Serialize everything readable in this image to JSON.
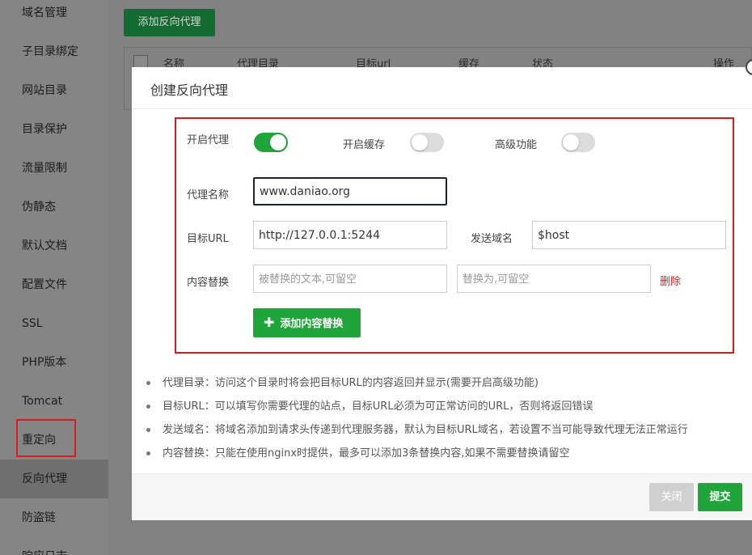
{
  "sidebar": {
    "items": [
      {
        "label": "域名管理"
      },
      {
        "label": "子目录绑定"
      },
      {
        "label": "网站目录"
      },
      {
        "label": "目录保护"
      },
      {
        "label": "流量限制"
      },
      {
        "label": "伪静态"
      },
      {
        "label": "默认文档"
      },
      {
        "label": "配置文件"
      },
      {
        "label": "SSL"
      },
      {
        "label": "PHP版本"
      },
      {
        "label": "Tomcat"
      },
      {
        "label": "重定向"
      },
      {
        "label": "反向代理"
      },
      {
        "label": "防盗链"
      },
      {
        "label": "响应日志"
      }
    ],
    "active": "反向代理"
  },
  "page": {
    "add_button": "添加反向代理",
    "table_headers": [
      "名称",
      "代理目录",
      "目标url",
      "缓存",
      "状态",
      "操作"
    ]
  },
  "modal": {
    "title": "创建反向代理",
    "toggles": {
      "enable_proxy": {
        "label": "开启代理",
        "on": true
      },
      "enable_cache": {
        "label": "开启缓存",
        "on": false
      },
      "advanced": {
        "label": "高级功能",
        "on": false
      }
    },
    "proxy_name": {
      "label": "代理名称",
      "value": "www.daniao.org"
    },
    "target_url": {
      "label": "目标URL",
      "value": "http://127.0.0.1:5244"
    },
    "send_domain": {
      "label": "发送域名",
      "value": "$host"
    },
    "content_replace": {
      "label": "内容替换",
      "from_placeholder": "被替换的文本,可留空",
      "to_placeholder": "替换为,可留空",
      "delete_label": "删除"
    },
    "add_replace_button": "添加内容替换",
    "help": [
      "代理目录：访问这个目录时将会把目标URL的内容返回并显示(需要开启高级功能)",
      "目标URL：可以填写你需要代理的站点，目标URL必须为可正常访问的URL，否则将返回错误",
      "发送域名：将域名添加到请求头传递到代理服务器，默认为目标URL域名，若设置不当可能导致代理无法正常运行",
      "内容替换：只能在使用nginx时提供，最多可以添加3条替换内容,如果不需要替换请留空"
    ],
    "footer": {
      "close_label": "关闭",
      "submit_label": "提交"
    }
  },
  "colors": {
    "accent_green": "#20a53a",
    "highlight_red": "#d71c1c",
    "delete_red": "#e02020"
  }
}
